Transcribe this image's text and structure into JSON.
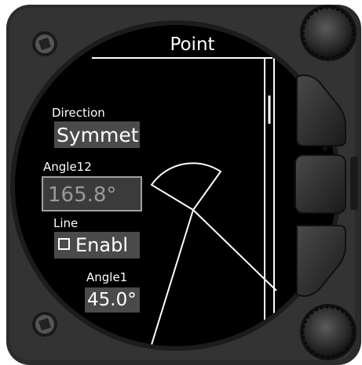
{
  "screen": {
    "title": "Point",
    "fields": {
      "direction": {
        "label": "Direction",
        "value": "Symmet"
      },
      "angle12": {
        "label": "Angle12",
        "value": "165.8°"
      },
      "line": {
        "label": "Line",
        "value": "Enabl",
        "checked": false
      },
      "angle1": {
        "label": "Angle1",
        "value": "45.0°"
      }
    }
  },
  "hardware": {
    "knobs": [
      "top-right-knob",
      "bottom-right-knob"
    ],
    "buttons": [
      "upper-soft-button",
      "middle-soft-button",
      "lower-soft-button"
    ]
  }
}
